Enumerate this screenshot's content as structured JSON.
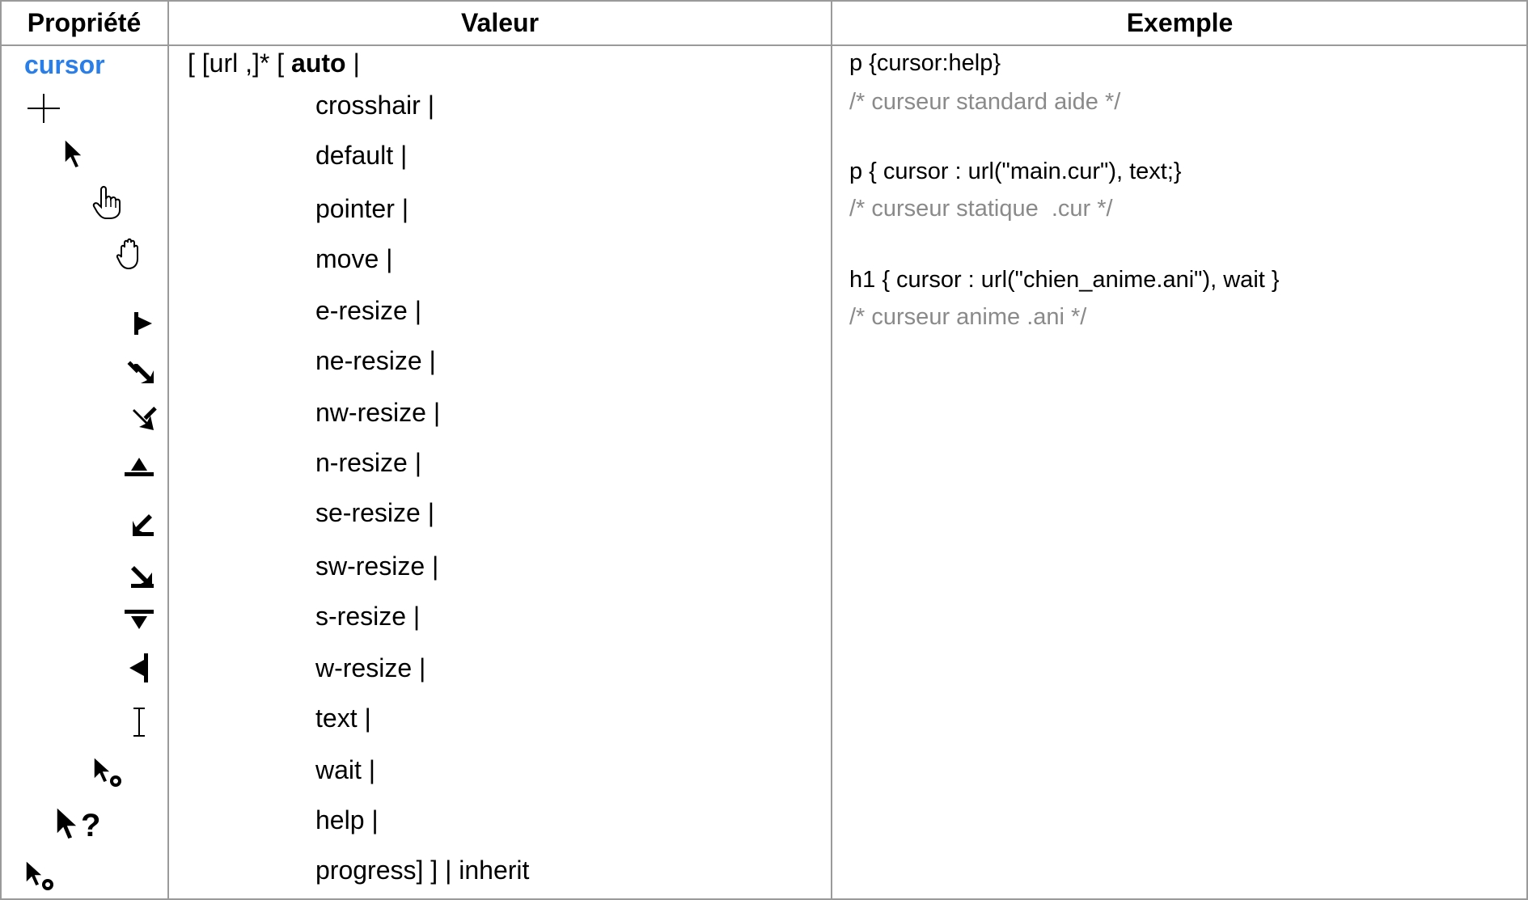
{
  "headers": {
    "property": "Propriété",
    "value": "Valeur",
    "example": "Exemple"
  },
  "property_name": "cursor",
  "colors": {
    "property_name": "#2a7ee8",
    "comment": "#8a8a8a",
    "grid": "#9a9a9a"
  },
  "value_prefix": {
    "before": "[ [url ,]* [ ",
    "bold": "auto",
    "after": " |"
  },
  "value_items": [
    "crosshair |",
    "default |",
    "pointer |",
    "move |",
    "e-resize |",
    "ne-resize |",
    "nw-resize |",
    "n-resize |",
    "se-resize |",
    "sw-resize |",
    "s-resize |",
    "w-resize |",
    "text |",
    "wait |",
    "help |",
    "progress] ] | inherit"
  ],
  "cursor_icons": [
    "crosshair-icon",
    "default-arrow-icon",
    "pointer-hand-icon",
    "move-hand-icon",
    "e-resize-icon",
    "ne-resize-icon",
    "nw-resize-icon",
    "n-resize-icon",
    "se-resize-icon",
    "sw-resize-icon",
    "s-resize-icon",
    "w-resize-icon",
    "text-ibeam-icon",
    "wait-icon",
    "help-icon",
    "progress-icon"
  ],
  "examples": [
    {
      "code": "p {cursor:help}",
      "comment": "/* curseur standard aide */"
    },
    {
      "code": "p { cursor : url(\"main.cur\"), text;}",
      "comment": "/* curseur statique  .cur */"
    },
    {
      "code": "h1 { cursor : url(\"chien_anime.ani\"), wait }",
      "comment": "/* curseur anime .ani */"
    }
  ]
}
